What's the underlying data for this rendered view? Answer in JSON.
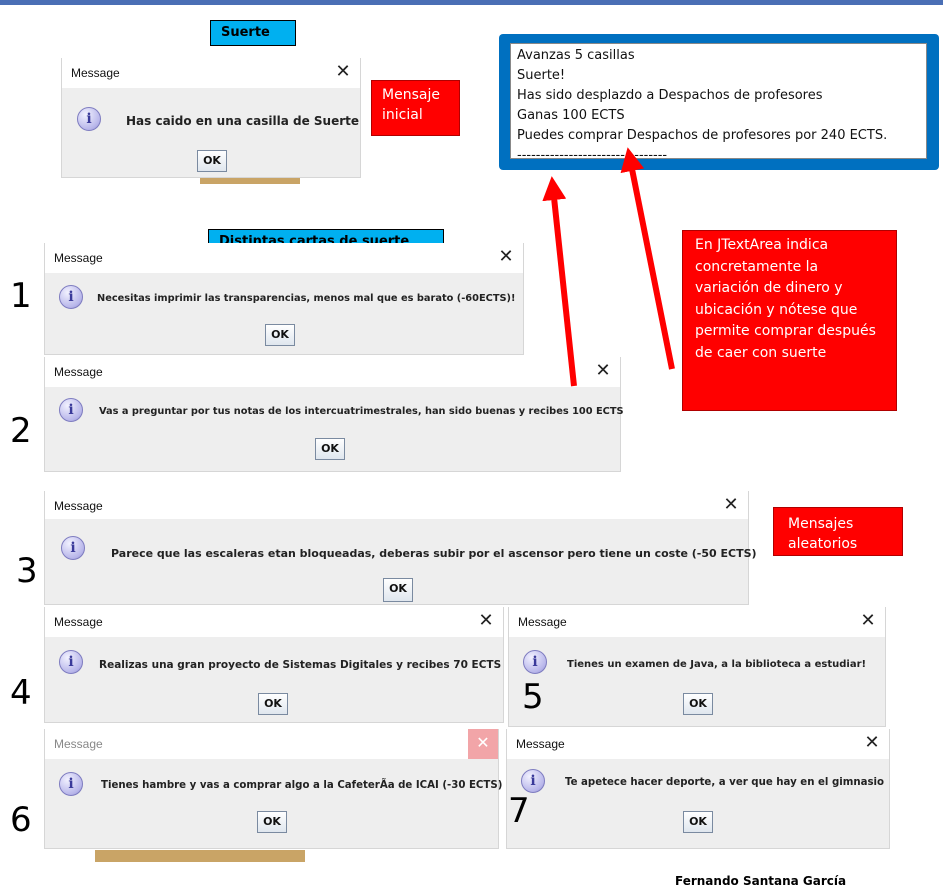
{
  "labels": {
    "suerte": "Suerte",
    "cartas": "Distintas cartas de suerte"
  },
  "notes": {
    "mensaje_inicial": "Mensaje inicial",
    "jtextarea": "En JTextArea indica concretamente la variación de dinero y ubicación y nótese que permite comprar después de caer con suerte",
    "aleatorios": "Mensajes aleatorios"
  },
  "textarea": {
    "lines": [
      "Avanzas 5 casillas",
      "Suerte!",
      "Has sido desplazdo a Despachos de profesores",
      "Ganas 100 ECTS",
      "Puedes comprar Despachos de profesores por 240 ECTS.",
      "--------------------------------"
    ]
  },
  "dialogs": [
    {
      "title": "Message",
      "close": "✕",
      "message": "Has caido en una casilla de Suerte",
      "ok": "OK"
    },
    {
      "number": "1",
      "title": "Message",
      "close": "✕",
      "message": "Necesitas imprimir las transparencias, menos mal que es barato (-60ECTS)!",
      "ok": "OK"
    },
    {
      "number": "2",
      "title": "Message",
      "close": "✕",
      "message": "Vas a preguntar por tus notas de los intercuatrimestrales, han sido buenas y recibes 100 ECTS",
      "ok": "OK"
    },
    {
      "number": "3",
      "title": "Message",
      "close": "✕",
      "message": "Parece que las escaleras etan bloqueadas, deberas subir por el ascensor pero tiene un coste (-50 ECTS)",
      "ok": "OK"
    },
    {
      "number": "4",
      "title": "Message",
      "close": "✕",
      "message": "Realizas una gran proyecto de Sistemas Digitales y recibes 70 ECTS",
      "ok": "OK"
    },
    {
      "number": "5",
      "title": "Message",
      "close": "✕",
      "message": "Tienes un examen de Java, a la biblioteca a estudiar!",
      "ok": "OK"
    },
    {
      "number": "6",
      "title": "Message",
      "close": "✕",
      "message": "Tienes hambre y vas a comprar algo a la CafeterÃ­a de ICAI (-30 ECTS)",
      "ok": "OK"
    },
    {
      "number": "7",
      "title": "Message",
      "close": "✕",
      "message": "Te apetece hacer deporte, a ver que hay en el gimnasio",
      "ok": "OK"
    }
  ],
  "icons": {
    "info": "information-icon",
    "close": "close-icon"
  },
  "colors": {
    "label_blue": "#00b0f0",
    "note_red": "#ff0000",
    "frame_blue": "#0070c0",
    "close_red": "#e81123"
  },
  "credit": "Fernando Santana García"
}
